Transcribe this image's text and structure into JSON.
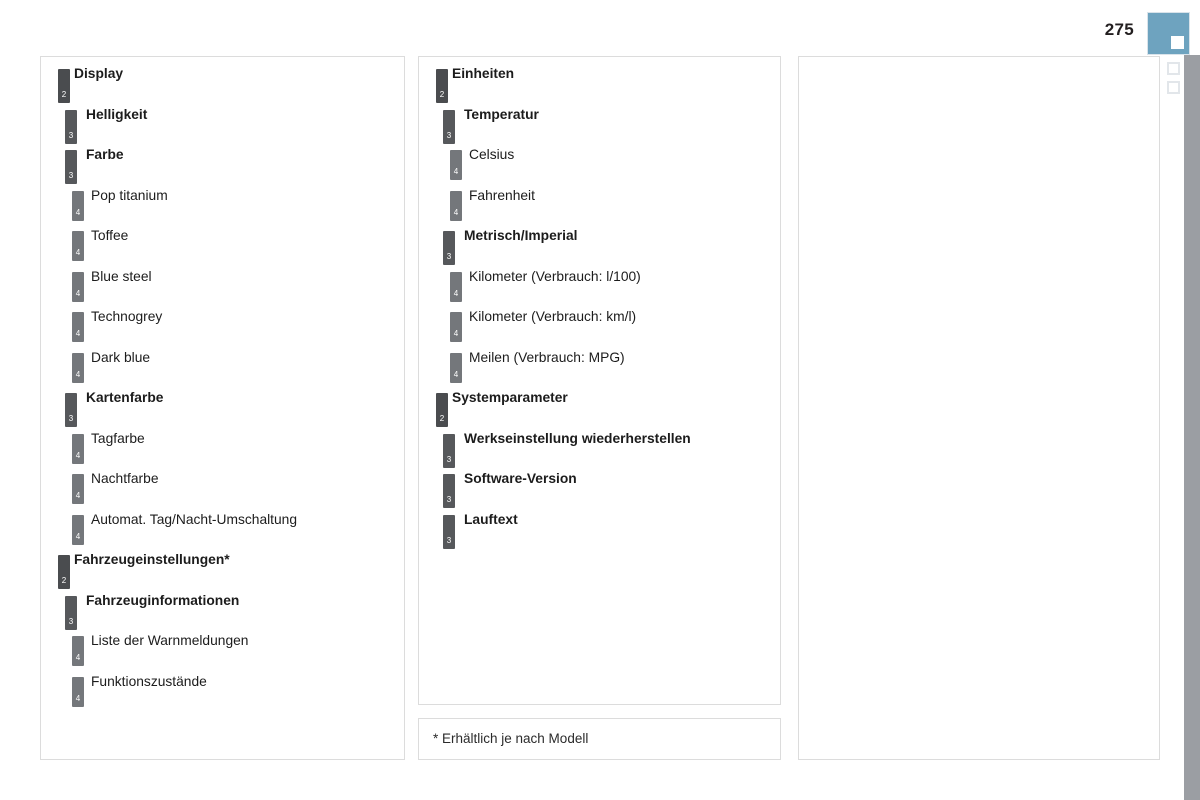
{
  "page": {
    "number": "275",
    "marker_color": "#6ea3bf",
    "edge_band_color": "#9b9ea3"
  },
  "columns": [
    {
      "id": "column-left",
      "entries": [
        {
          "level": 2,
          "marker": "2",
          "label": "Display"
        },
        {
          "level": 3,
          "marker": "3",
          "label": "Helligkeit"
        },
        {
          "level": 3,
          "marker": "3",
          "label": "Farbe"
        },
        {
          "level": 4,
          "marker": "4",
          "label": "Pop titanium"
        },
        {
          "level": 4,
          "marker": "4",
          "label": "Toffee"
        },
        {
          "level": 4,
          "marker": "4",
          "label": "Blue steel"
        },
        {
          "level": 4,
          "marker": "4",
          "label": "Technogrey"
        },
        {
          "level": 4,
          "marker": "4",
          "label": "Dark blue"
        },
        {
          "level": 3,
          "marker": "3",
          "label": "Kartenfarbe"
        },
        {
          "level": 4,
          "marker": "4",
          "label": "Tagfarbe"
        },
        {
          "level": 4,
          "marker": "4",
          "label": "Nachtfarbe"
        },
        {
          "level": 4,
          "marker": "4",
          "label": "Automat. Tag/Nacht-Umschaltung"
        },
        {
          "level": 2,
          "marker": "2",
          "label": "Fahrzeugeinstellungen*"
        },
        {
          "level": 3,
          "marker": "3",
          "label": "Fahrzeuginformationen"
        },
        {
          "level": 4,
          "marker": "4",
          "label": "Liste der Warnmeldungen"
        },
        {
          "level": 4,
          "marker": "4",
          "label": "Funktionszustände"
        }
      ]
    },
    {
      "id": "column-middle",
      "entries": [
        {
          "level": 2,
          "marker": "2",
          "label": "Einheiten"
        },
        {
          "level": 3,
          "marker": "3",
          "label": "Temperatur"
        },
        {
          "level": 4,
          "marker": "4",
          "label": "Celsius"
        },
        {
          "level": 4,
          "marker": "4",
          "label": "Fahrenheit"
        },
        {
          "level": 3,
          "marker": "3",
          "label": "Metrisch/Imperial"
        },
        {
          "level": 4,
          "marker": "4",
          "label": "Kilometer (Verbrauch: l/100)"
        },
        {
          "level": 4,
          "marker": "4",
          "label": "Kilometer (Verbrauch: km/l)"
        },
        {
          "level": 4,
          "marker": "4",
          "label": "Meilen (Verbrauch: MPG)"
        },
        {
          "level": 2,
          "marker": "2",
          "label": "Systemparameter"
        },
        {
          "level": 3,
          "marker": "3",
          "label": "Werkseinstellung wiederherstellen"
        },
        {
          "level": 3,
          "marker": "3",
          "label": "Software-Version"
        },
        {
          "level": 3,
          "marker": "3",
          "label": "Lauftext"
        }
      ]
    },
    {
      "id": "column-right",
      "entries": []
    }
  ],
  "footnote": {
    "text": "* Erhältlich je nach Modell"
  }
}
